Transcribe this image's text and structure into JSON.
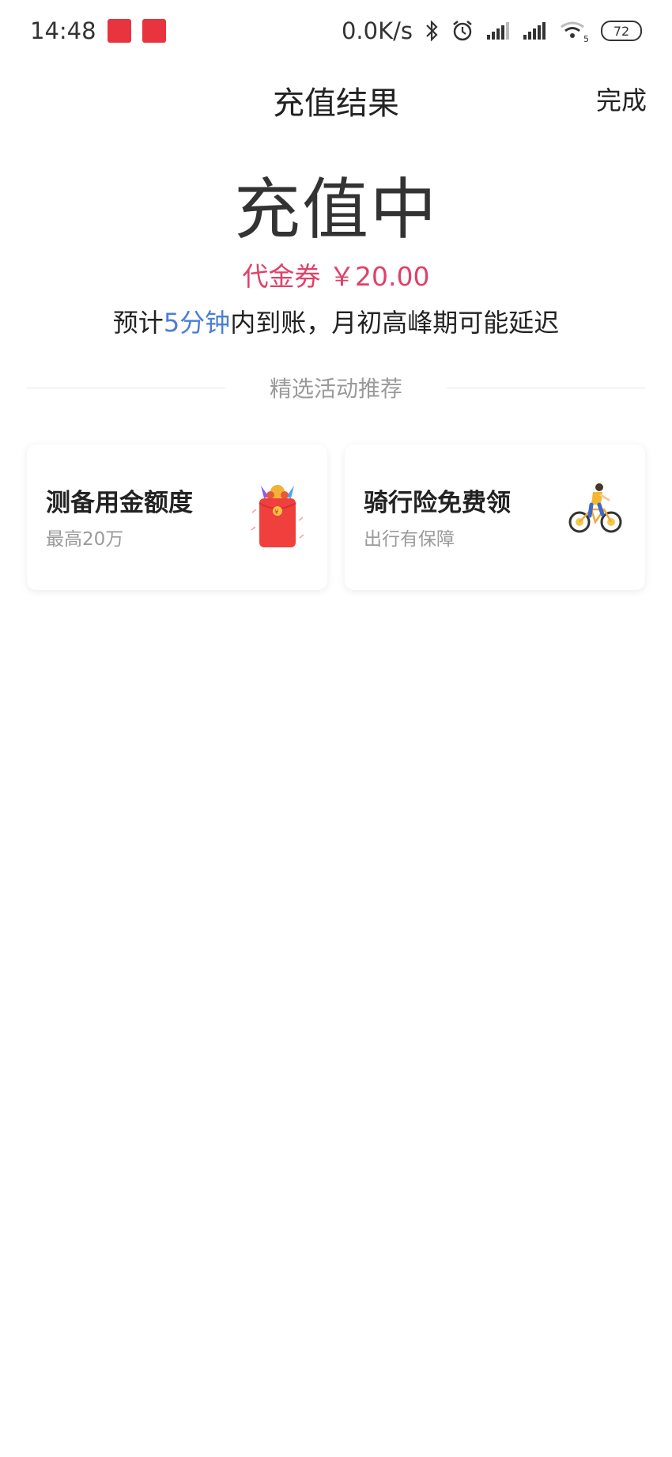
{
  "status_bar": {
    "time": "14:48",
    "network_speed": "0.0K/s",
    "battery": "72",
    "wifi_level": "5",
    "icons": [
      "app-badge-icon",
      "app-badge-icon",
      "bluetooth-icon",
      "alarm-icon",
      "signal-icon",
      "signal-icon",
      "wifi-icon",
      "battery-icon"
    ]
  },
  "header": {
    "title": "充值结果",
    "done_label": "完成"
  },
  "result": {
    "status": "充值中",
    "voucher_label": "代金券",
    "voucher_amount": "￥20.00",
    "eta_prefix": "预计",
    "eta_highlight": "5分钟",
    "eta_suffix": "内到账，月初高峰期可能延迟"
  },
  "section": {
    "title": "精选活动推荐"
  },
  "cards": [
    {
      "title": "测备用金额度",
      "subtitle": "最高20万",
      "icon": "red-envelope-icon"
    },
    {
      "title": "骑行险免费领",
      "subtitle": "出行有保障",
      "icon": "cyclist-icon"
    }
  ],
  "colors": {
    "voucher": "#e04169",
    "highlight": "#4b7ed8",
    "muted": "#9a9a9a",
    "text": "#222222"
  }
}
